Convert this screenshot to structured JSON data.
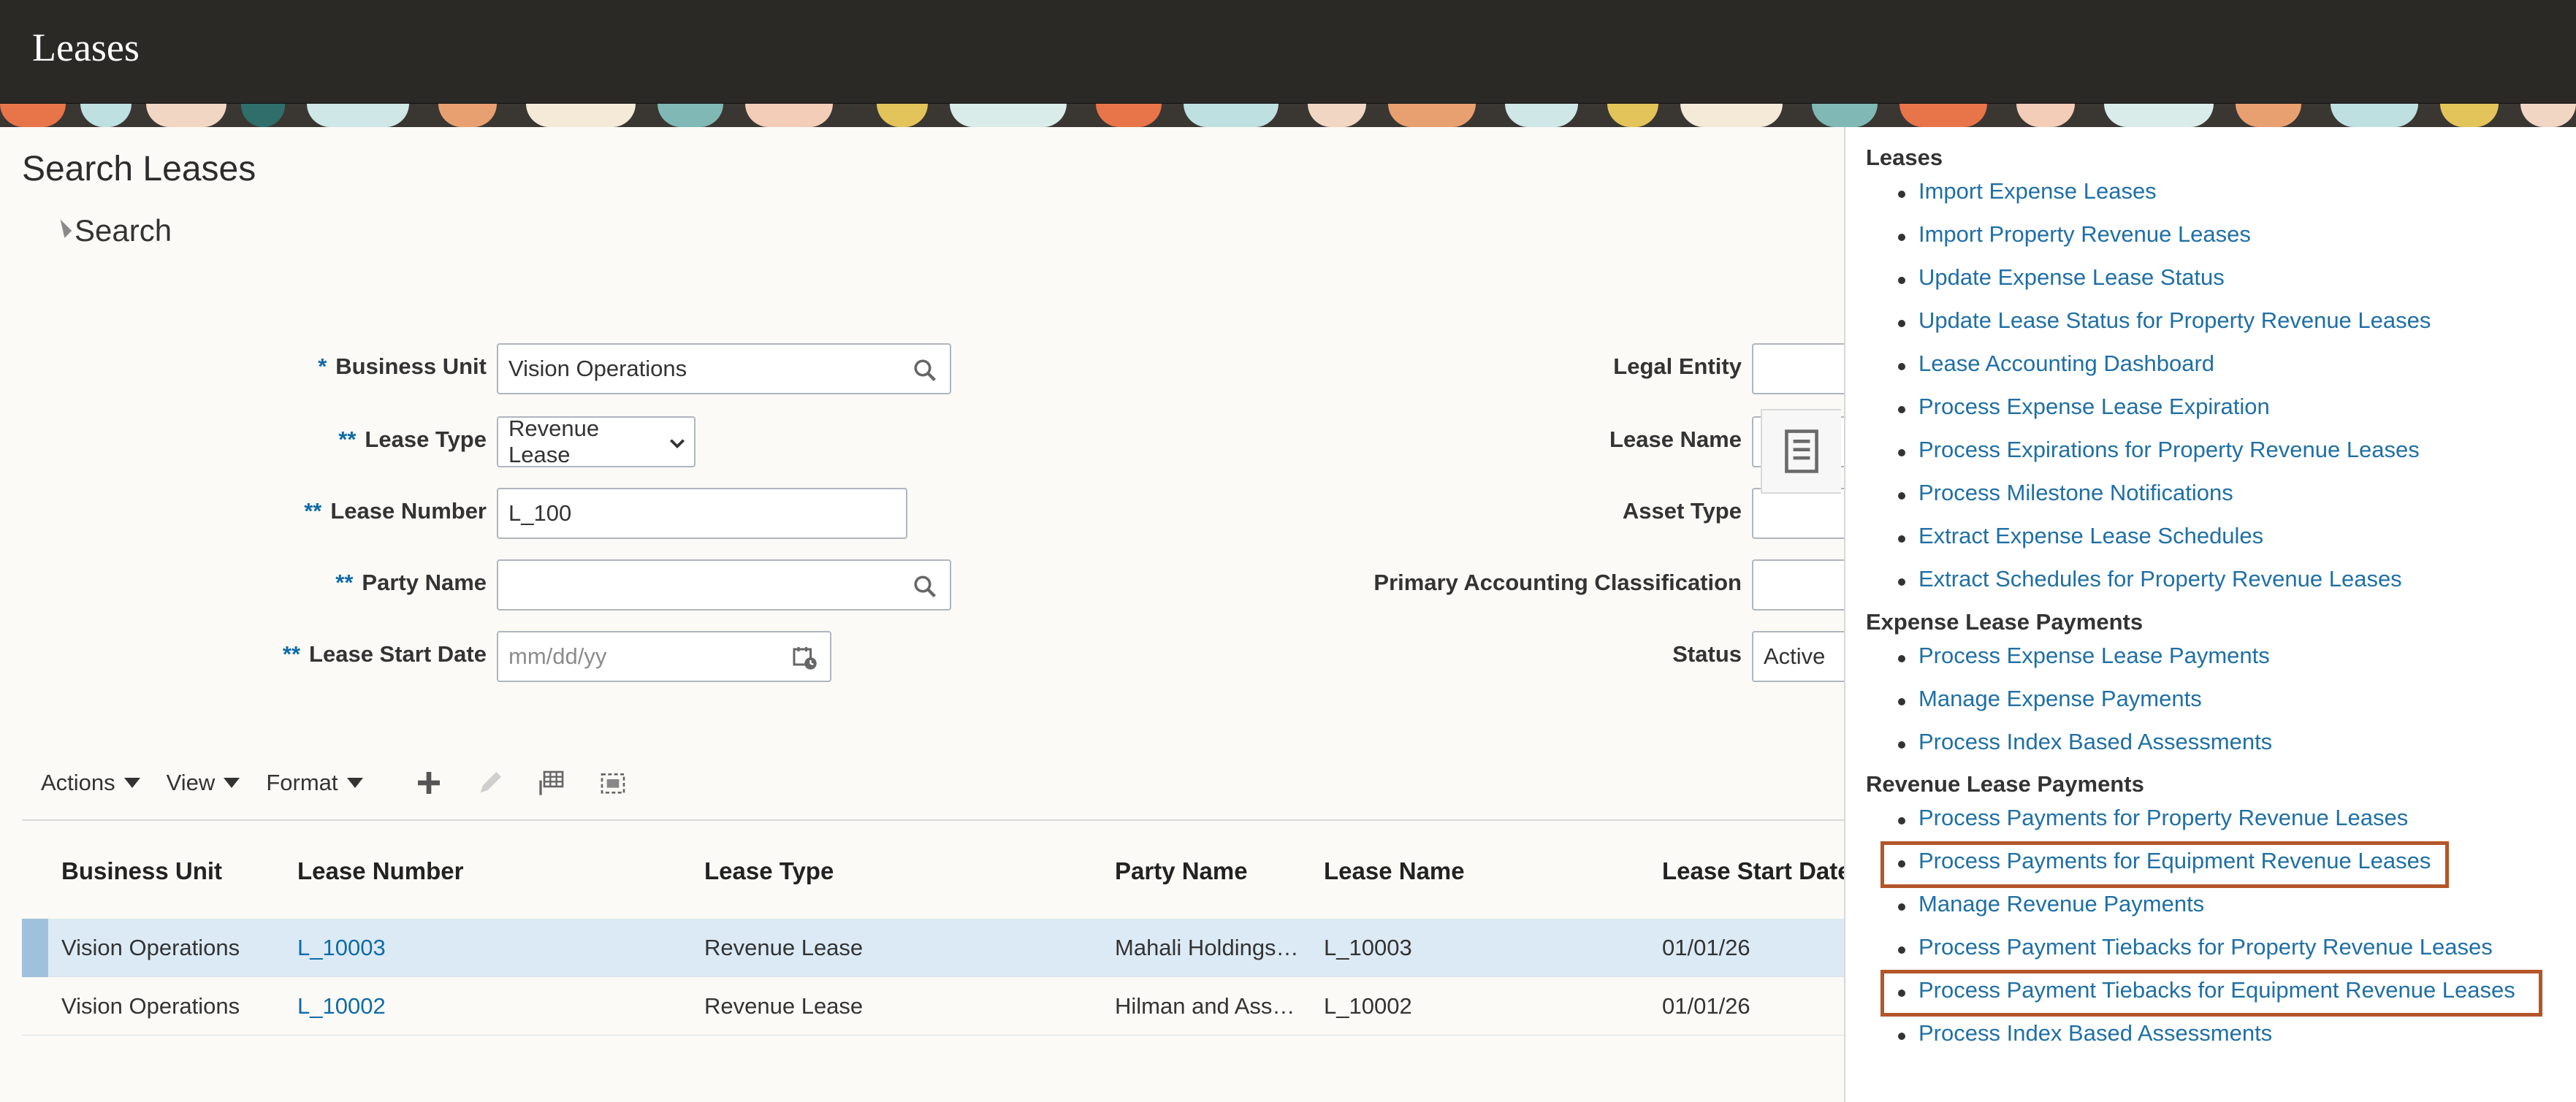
{
  "app": {
    "title": "Leases"
  },
  "page": {
    "title": "Search Leases",
    "search_section": "Search"
  },
  "form": {
    "business_unit": {
      "label": "Business Unit",
      "marker": "*",
      "value": "Vision Operations"
    },
    "lease_type": {
      "label": "Lease Type",
      "marker": "**",
      "value": "Revenue Lease"
    },
    "lease_number": {
      "label": "Lease Number",
      "marker": "**",
      "value": "L_100"
    },
    "party_name": {
      "label": "Party Name",
      "marker": "**",
      "value": ""
    },
    "lease_start_date": {
      "label": "Lease Start Date",
      "marker": "**",
      "placeholder": "mm/dd/yy"
    },
    "legal_entity": {
      "label": "Legal Entity",
      "value": ""
    },
    "lease_name": {
      "label": "Lease Name",
      "value": ""
    },
    "asset_type": {
      "label": "Asset Type",
      "value": ""
    },
    "primary_accounting_classification": {
      "label": "Primary Accounting Classification",
      "value": ""
    },
    "status": {
      "label": "Status",
      "value": "Active"
    }
  },
  "toolbar": {
    "actions": "Actions",
    "view": "View",
    "format": "Format"
  },
  "table": {
    "columns": [
      "Business Unit",
      "Lease Number",
      "Lease Type",
      "Party Name",
      "Lease Name",
      "Lease Start Date"
    ],
    "rows": [
      [
        "Vision Operations",
        "L_10003",
        "Revenue Lease",
        "Mahali Holdings…",
        "L_10003",
        "01/01/26"
      ],
      [
        "Vision Operations",
        "L_10002",
        "Revenue Lease",
        "Hilman and Ass…",
        "L_10002",
        "01/01/26"
      ]
    ]
  },
  "tasks": {
    "sections": [
      {
        "title": "Leases",
        "items": [
          "Import Expense Leases",
          "Import Property Revenue Leases",
          "Update Expense Lease Status",
          "Update Lease Status for Property Revenue Leases",
          "Lease Accounting Dashboard",
          "Process Expense Lease Expiration",
          "Process Expirations for Property Revenue Leases",
          "Process Milestone Notifications",
          "Extract Expense Lease Schedules",
          "Extract Schedules for Property Revenue Leases"
        ]
      },
      {
        "title": "Expense Lease Payments",
        "items": [
          "Process Expense Lease Payments",
          "Manage Expense Payments",
          "Process Index Based Assessments"
        ]
      },
      {
        "title": "Revenue Lease Payments",
        "items": [
          "Process Payments for Property Revenue Leases",
          "Process Payments for Equipment Revenue Leases",
          "Manage Revenue Payments",
          "Process Payment Tiebacks for Property Revenue Leases",
          "Process Payment Tiebacks for Equipment Revenue Leases",
          "Process Index Based Assessments"
        ]
      }
    ]
  },
  "colors": {
    "link": "#1f6fa6",
    "highlight_box": "#b4552a",
    "header_bg": "#2b2926"
  }
}
